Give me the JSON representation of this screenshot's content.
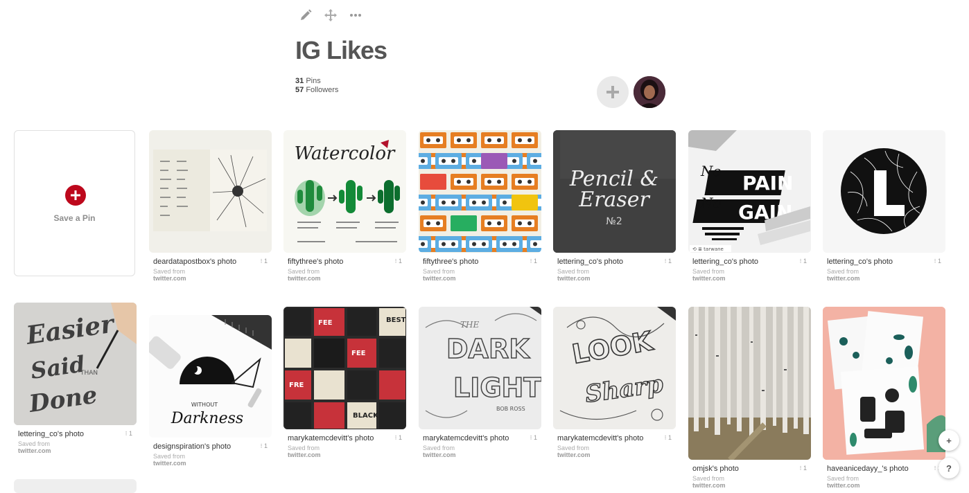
{
  "toolbar": {
    "icons": [
      "pencil-icon",
      "move-icon",
      "more-icon"
    ]
  },
  "board": {
    "title": "IG Likes",
    "pins_count": "31",
    "pins_label": "Pins",
    "followers_count": "57",
    "followers_label": "Followers"
  },
  "save_pin": {
    "label": "Save a Pin"
  },
  "pins": [
    {
      "desc": "deardatapostbox's photo",
      "repins": "1",
      "saved_from": "Saved from",
      "source": "twitter.com"
    },
    {
      "desc": "fiftythree's photo",
      "repins": "1",
      "saved_from": "Saved from",
      "source": "twitter.com",
      "img_text": "Watercolor"
    },
    {
      "desc": "fiftythree's photo",
      "repins": "1",
      "saved_from": "Saved from",
      "source": "twitter.com"
    },
    {
      "desc": "lettering_co's photo",
      "repins": "1",
      "saved_from": "Saved from",
      "source": "twitter.com",
      "img_text": "Pencil & Eraser"
    },
    {
      "desc": "lettering_co's photo",
      "repins": "1",
      "saved_from": "Saved from",
      "source": "twitter.com",
      "img_text": "No PAIN No GAIN"
    },
    {
      "desc": "lettering_co's photo",
      "repins": "1",
      "saved_from": "Saved from",
      "source": "twitter.com",
      "img_text": "L"
    },
    {
      "desc": "lettering_co's photo",
      "repins": "1",
      "saved_from": "Saved from",
      "source": "twitter.com",
      "img_text": "Easier Said Than Done"
    },
    {
      "desc": "designspiration's photo",
      "repins": "1",
      "saved_from": "Saved from",
      "source": "twitter.com",
      "img_text": "Darkness"
    },
    {
      "desc": "marykatemcdevitt's photo",
      "repins": "1",
      "saved_from": "Saved from",
      "source": "twitter.com"
    },
    {
      "desc": "marykatemcdevitt's photo",
      "repins": "1",
      "saved_from": "Saved from",
      "source": "twitter.com",
      "img_text": "DARK LIGHT"
    },
    {
      "desc": "marykatemcdevitt's photo",
      "repins": "1",
      "saved_from": "Saved from",
      "source": "twitter.com",
      "img_text": "LOOK Sharp"
    },
    {
      "desc": "omjsk's photo",
      "repins": "1",
      "saved_from": "Saved from",
      "source": "twitter.com"
    },
    {
      "desc": "haveanicedayy_'s photo",
      "repins": "1",
      "saved_from": "Saved from",
      "source": "twitter.com"
    }
  ],
  "fab": {
    "add": "+",
    "help": "?"
  },
  "colors": {
    "brand_red": "#bd081c",
    "title_gray": "#555555"
  }
}
